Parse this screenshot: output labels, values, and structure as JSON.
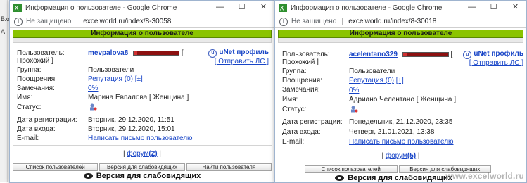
{
  "background": {
    "text1": "Вхо",
    "text2": "А"
  },
  "windows": [
    {
      "title": "Информация о пользователе - Google Chrome",
      "insecure": "Не защищено",
      "url": "excelworld.ru/index/8-30058",
      "header": "Информация о пользователе",
      "labels": {
        "user": "Пользователь:",
        "prohozhiy": "Прохожий ]",
        "group": "Группа:",
        "rewards": "Поощрения:",
        "remarks": "Замечания:",
        "name": "Имя:",
        "status": "Статус:",
        "regdate": "Дата регистрации:",
        "logindate": "Дата входа:",
        "email": "E-mail:"
      },
      "nickname": "mevpalova8",
      "bracket_open": "[",
      "unet": "uNet профиль",
      "send_pm": "[ Отправить ЛС ]",
      "group": "Пользователи",
      "reputation": "Репутация (0)",
      "rep_extra": "[±]",
      "remarks": "0%",
      "name": "Марина Евпалова [ Женщина ]",
      "regdate": "Вторник, 29.12.2020, 11:51",
      "logindate": "Вторник, 29.12.2020, 15:01",
      "email": "Написать письмо пользователю",
      "forum_open": "|",
      "forum_label": "форум",
      "forum_count": "(2)",
      "forum_close": "|",
      "buttons": [
        "Список пользователей",
        "Версия для слабовидящих",
        "Найти пользователя"
      ],
      "vision": "Версия для слабовидящих"
    },
    {
      "title": "Информация о пользователе - Google Chrome",
      "insecure": "Не защищено",
      "url": "excelworld.ru/index/8-30018",
      "header": "Информация о пользователе",
      "labels": {
        "user": "Пользователь:",
        "prohozhiy": "Прохожий ]",
        "group": "Группа:",
        "rewards": "Поощрения:",
        "remarks": "Замечания:",
        "name": "Имя:",
        "status": "Статус:",
        "regdate": "Дата регистрации:",
        "logindate": "Дата входа:",
        "email": "E-mail:"
      },
      "nickname": "acelentano329",
      "bracket_open": "[",
      "unet": "uNet профиль",
      "send_pm": "[ Отправить ЛС ]",
      "group": "Пользователи",
      "reputation": "Репутация (0)",
      "rep_extra": "[±]",
      "remarks": "0%",
      "name": "Адриано Челентано [ Женщина ]",
      "regdate": "Понедельник, 21.12.2020, 23:35",
      "logindate": "Четверг, 21.01.2021, 13:38",
      "email": "Написать письмо пользователю",
      "forum_open": "|",
      "forum_label": "форум",
      "forum_count": "(5)",
      "forum_close": "|",
      "buttons": [
        "Список пользователей",
        "Версия для слабовидящих"
      ],
      "vision": "Версия для слабовидящих"
    }
  ],
  "watermark": "www.excelworld.ru"
}
